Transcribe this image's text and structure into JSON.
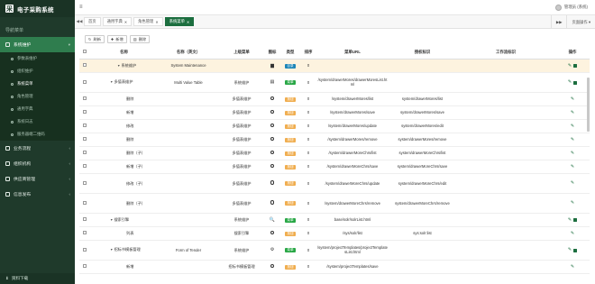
{
  "app": {
    "title": "电子采购系统",
    "logo_char": "采"
  },
  "colors": {
    "sidebar_bg": "#1f3a2b",
    "accent": "#1c6e3f",
    "dir_badge": "#1b85b8",
    "menu_badge": "#28a745",
    "btn_badge": "#f0ad4e",
    "highlight_row": "#fdf3df"
  },
  "sidebar": {
    "header": "导航菜单",
    "group": {
      "label": "系统维护",
      "icon": "gear-icon"
    },
    "subitems": [
      {
        "label": "参数表维护",
        "active": false
      },
      {
        "label": "组织维护",
        "active": false
      },
      {
        "label": "系统菜单",
        "active": true
      },
      {
        "label": "角色管理",
        "active": false
      },
      {
        "label": "通用字典",
        "active": false
      },
      {
        "label": "系统日志",
        "active": false
      },
      {
        "label": "服务器端二维码",
        "active": false
      }
    ],
    "others": [
      {
        "label": "业务流程",
        "icon": "flow-icon"
      },
      {
        "label": "组织机构",
        "icon": "org-icon"
      },
      {
        "label": "供应商管理",
        "icon": "supplier-icon"
      },
      {
        "label": "信息发布",
        "icon": "info-icon"
      }
    ],
    "footer": "资料下载"
  },
  "topbar": {
    "menu_icon": "≡",
    "user": "管理员 (系统)"
  },
  "tabs": {
    "items": [
      {
        "label": "首页",
        "closable": false,
        "active": false
      },
      {
        "label": "通用字典",
        "closable": true,
        "active": false
      },
      {
        "label": "角色管理",
        "closable": true,
        "active": false
      },
      {
        "label": "系统菜单",
        "closable": true,
        "active": true
      }
    ],
    "prev": "◀◀",
    "next": "▶▶",
    "page_ops": "页面操作 ▾"
  },
  "toolbar": {
    "refresh": "刷新",
    "add": "新增",
    "delete": "删除"
  },
  "table": {
    "headers": [
      "名称",
      "名称（英文）",
      "上级菜单",
      "图标",
      "类型",
      "排序",
      "菜单URL",
      "授权标识",
      "工作流标识",
      "操作"
    ],
    "rows": [
      {
        "level": 1,
        "expand": true,
        "name": "系统维护",
        "name_en": "System Maintenance",
        "parent": "",
        "icon": "▆",
        "type": "dir",
        "type_label": "目录",
        "sort": "0",
        "url": "",
        "perm": "",
        "wf": "",
        "actions": [
          "edit",
          "add"
        ],
        "highlight": true,
        "tall": false
      },
      {
        "level": 2,
        "expand": true,
        "name": "多值表维护",
        "name_en": "Multi Value Table",
        "parent": "系统维护",
        "icon": "▤",
        "type": "menu",
        "type_label": "菜单",
        "sort": "0",
        "url": "/system/drawerMores/drawerMoresList.html",
        "perm": "",
        "wf": "",
        "actions": [
          "edit",
          "add"
        ],
        "highlight": false,
        "tall": true
      },
      {
        "level": 3,
        "expand": false,
        "name": "删除",
        "name_en": "",
        "parent": "多值表维护",
        "icon": "ring",
        "type": "btn",
        "type_label": "按钮",
        "sort": "0",
        "url": "/system/drawerMores/list",
        "perm": "system/drawerMores/list",
        "wf": "",
        "actions": [
          "edit"
        ],
        "highlight": false,
        "tall": false
      },
      {
        "level": 3,
        "expand": false,
        "name": "新增",
        "name_en": "",
        "parent": "多值表维护",
        "icon": "ring",
        "type": "btn",
        "type_label": "按钮",
        "sort": "0",
        "url": "/system/drawerMores/save",
        "perm": "system/drawerMores/save",
        "wf": "",
        "actions": [
          "edit"
        ],
        "highlight": false,
        "tall": false
      },
      {
        "level": 3,
        "expand": false,
        "name": "修改",
        "name_en": "",
        "parent": "多值表维护",
        "icon": "ring",
        "type": "btn",
        "type_label": "按钮",
        "sort": "0",
        "url": "/system/drawerMores/update",
        "perm": "system/drawerMores/edit",
        "wf": "",
        "actions": [
          "edit"
        ],
        "highlight": false,
        "tall": false
      },
      {
        "level": 3,
        "expand": false,
        "name": "删除",
        "name_en": "",
        "parent": "多值表维护",
        "icon": "ring",
        "type": "btn",
        "type_label": "按钮",
        "sort": "0",
        "url": "/system/drawerMores/remove",
        "perm": "system/drawerMores/remove",
        "wf": "",
        "actions": [
          "edit"
        ],
        "highlight": false,
        "tall": false
      },
      {
        "level": 3,
        "expand": false,
        "name": "删除（子）",
        "name_en": "",
        "parent": "多值表维护",
        "icon": "ring",
        "type": "btn",
        "type_label": "按钮",
        "sort": "0",
        "url": "/system/drawerMoreChrs/list",
        "perm": "system/drawerMoreChrs/list",
        "wf": "",
        "actions": [
          "edit"
        ],
        "highlight": false,
        "tall": false
      },
      {
        "level": 3,
        "expand": false,
        "name": "新增（子）",
        "name_en": "",
        "parent": "多值表维护",
        "icon": "ring",
        "type": "btn",
        "type_label": "按钮",
        "sort": "0",
        "url": "/system/drawerMoreChrs/save",
        "perm": "system/drawerMoreChrs/save",
        "wf": "",
        "actions": [
          "edit"
        ],
        "highlight": false,
        "tall": false
      },
      {
        "level": 3,
        "expand": false,
        "name": "修改（子）",
        "name_en": "",
        "parent": "多值表维护",
        "icon": "ring",
        "type": "btn",
        "type_label": "按钮",
        "sort": "0",
        "url": "/system/drawerMoreChrs/update",
        "perm": "system/drawerMoreChrs/edit",
        "wf": "",
        "actions": [
          "edit"
        ],
        "highlight": false,
        "tall": true
      },
      {
        "level": 3,
        "expand": false,
        "name": "删除（子）",
        "name_en": "",
        "parent": "多值表维护",
        "icon": "ring",
        "type": "btn",
        "type_label": "按钮",
        "sort": "0",
        "url": "/system/drawerMoreChrs/remove",
        "perm": "system/drawerMoreChrs/remove",
        "wf": "",
        "actions": [
          "edit"
        ],
        "highlight": false,
        "tall": true
      },
      {
        "level": 2,
        "expand": true,
        "name": "搜索引擎",
        "name_en": "",
        "parent": "系统维护",
        "icon": "🔍",
        "type": "menu",
        "type_label": "菜单",
        "sort": "0",
        "url": "base/solr/solrList.html",
        "perm": "",
        "wf": "",
        "actions": [
          "edit",
          "add"
        ],
        "highlight": false,
        "tall": false
      },
      {
        "level": 3,
        "expand": false,
        "name": "列表",
        "name_en": "",
        "parent": "搜索引擎",
        "icon": "ring",
        "type": "btn",
        "type_label": "按钮",
        "sort": "0",
        "url": "/sys/solr/list",
        "perm": "sys:solr:list",
        "wf": "",
        "actions": [
          "edit"
        ],
        "highlight": false,
        "tall": false
      },
      {
        "level": 2,
        "expand": true,
        "name": "招标书模板管理",
        "name_en": "Form of Tender",
        "parent": "系统维护",
        "icon": "⚙",
        "type": "menu",
        "type_label": "菜单",
        "sort": "0",
        "url": "/system/projectTemplates/projectTemplatesList.html",
        "perm": "",
        "wf": "",
        "actions": [
          "edit",
          "add"
        ],
        "highlight": false,
        "tall": true
      },
      {
        "level": 3,
        "expand": false,
        "name": "新增",
        "name_en": "",
        "parent": "招标书模板管理",
        "icon": "ring",
        "type": "btn",
        "type_label": "按钮",
        "sort": "0",
        "url": "/system/projectTemplates/save",
        "perm": "",
        "wf": "",
        "actions": [
          "edit"
        ],
        "highlight": false,
        "tall": false
      }
    ]
  }
}
